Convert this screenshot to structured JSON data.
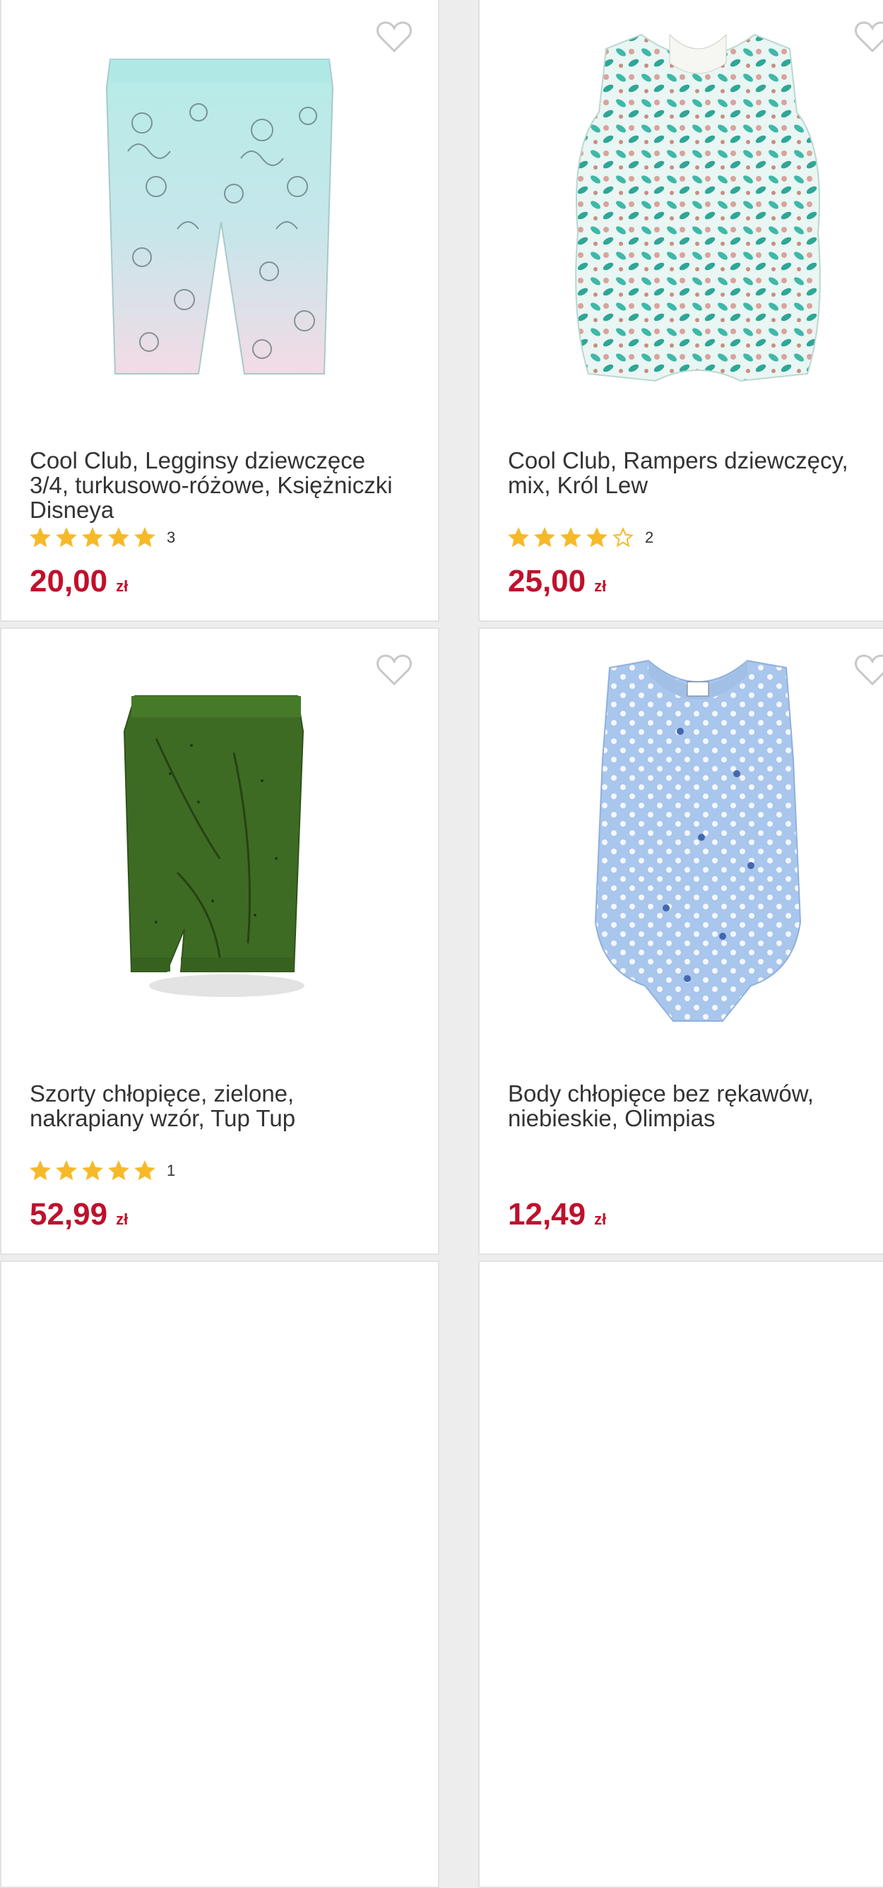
{
  "products": [
    {
      "name": "Cool Club, Legginsy dziewczęce 3/4, turkusowo-różowe, Księżniczki Disneya",
      "rating_stars": 5,
      "rating_count": "3",
      "price": "20,00",
      "currency": "zł",
      "image": "turquoise-pink-leggings"
    },
    {
      "name": "Cool Club, Rampers dziewczęcy, mix, Król Lew",
      "rating_stars": 4,
      "rating_count": "2",
      "price": "25,00",
      "currency": "zł",
      "image": "floral-romper"
    },
    {
      "name": "Szorty chłopięce, zielone, nakrapiany wzór, Tup Tup",
      "rating_stars": 5,
      "rating_count": "1",
      "price": "52,99",
      "currency": "zł",
      "image": "green-shorts"
    },
    {
      "name": "Body chłopięce bez rękawów, niebieskie, Olimpias",
      "rating_stars": 0,
      "rating_count": "",
      "price": "12,49",
      "currency": "zł",
      "image": "blue-dotted-bodysuit"
    }
  ],
  "colors": {
    "price": "#c0102c",
    "star": "#f6b928",
    "heart_outline": "#c8c8c8"
  }
}
